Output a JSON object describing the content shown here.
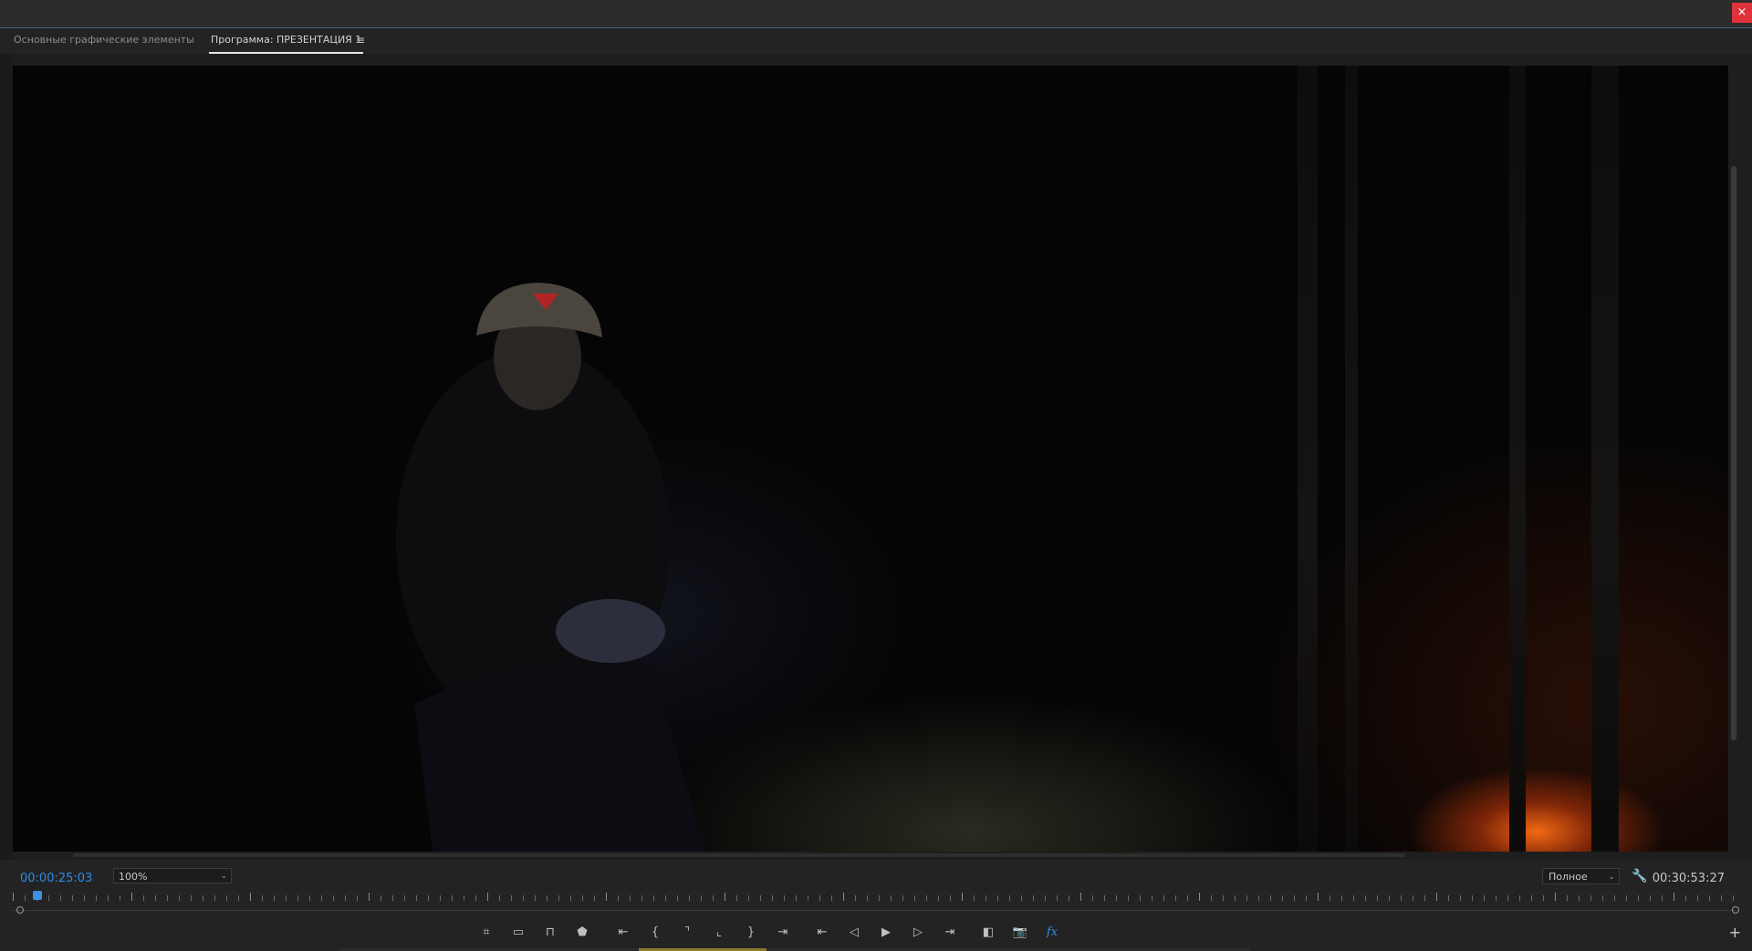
{
  "window": {
    "close_label": "×"
  },
  "tabs": [
    {
      "label": "Основные графические элементы"
    },
    {
      "label": "Программа: ПРЕЗЕНТАЦИЯ 1"
    }
  ],
  "tab_menu": "≡",
  "monitor": {
    "current_timecode": "00:00:25:03",
    "duration_timecode": "00:30:53:27",
    "zoom": "100%",
    "quality": "Полное"
  },
  "icons": {
    "chevron": "⌄",
    "wrench": "🔧",
    "add": "+"
  },
  "transport": [
    {
      "name": "safe-margins-icon",
      "glyph": "⌗"
    },
    {
      "name": "overlay-icon",
      "glyph": "▭"
    },
    {
      "name": "captions-icon",
      "glyph": "⊓"
    },
    {
      "name": "add-marker-icon",
      "glyph": "⬟"
    },
    {
      "name": "go-to-in-edit-icon",
      "glyph": "⇤"
    },
    {
      "name": "mark-in-icon",
      "glyph": "{"
    },
    {
      "name": "mark-out-left-icon",
      "glyph": "⌝"
    },
    {
      "name": "mark-clip-icon",
      "glyph": "⌞"
    },
    {
      "name": "mark-out-icon",
      "glyph": "}"
    },
    {
      "name": "go-to-out-edit-icon",
      "glyph": "⇥"
    },
    {
      "name": "go-to-in-icon",
      "glyph": "⇤"
    },
    {
      "name": "step-back-icon",
      "glyph": "◁"
    },
    {
      "name": "play-icon",
      "glyph": "▶"
    },
    {
      "name": "step-forward-icon",
      "glyph": "▷"
    },
    {
      "name": "go-to-out-icon",
      "glyph": "⇥"
    },
    {
      "name": "comparison-view-icon",
      "glyph": "◧"
    },
    {
      "name": "export-frame-icon",
      "glyph": "📷"
    },
    {
      "name": "effects-icon",
      "glyph": "fx"
    }
  ]
}
